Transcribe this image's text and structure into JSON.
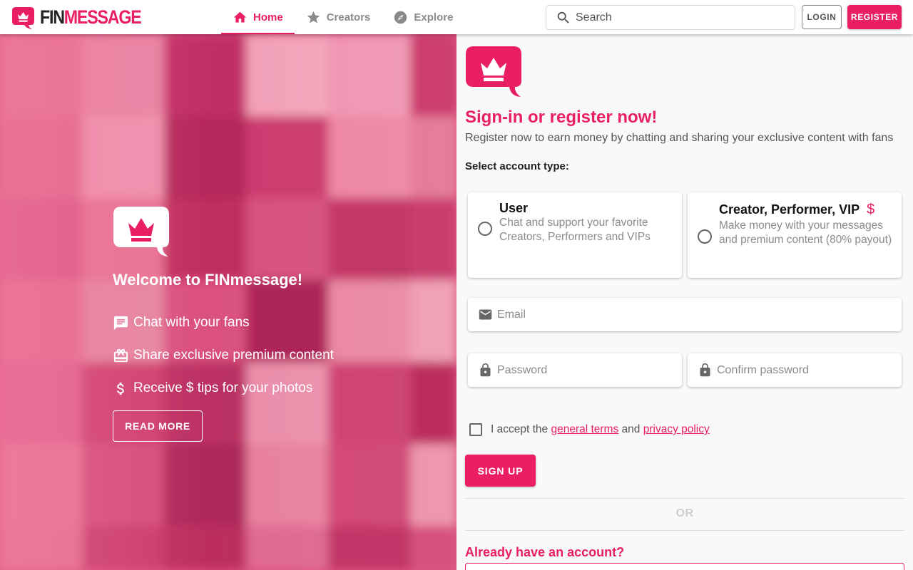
{
  "brand": {
    "name_part1": "FIN",
    "name_part2": "MESSAGE",
    "accent_color": "#e91e63",
    "logo_icon": "crown-chat-bubble-icon"
  },
  "nav": {
    "tabs": [
      {
        "label": "Home",
        "icon": "home-icon",
        "active": true
      },
      {
        "label": "Creators",
        "icon": "star-icon",
        "active": false
      },
      {
        "label": "Explore",
        "icon": "compass-icon",
        "active": false
      }
    ]
  },
  "search": {
    "placeholder": "Search",
    "icon": "search-icon"
  },
  "auth_buttons": {
    "login": "LOGIN",
    "register": "REGISTER"
  },
  "hero": {
    "title": "Welcome to FINmessage!",
    "features": [
      {
        "icon": "chat-icon",
        "text": "Chat with your fans"
      },
      {
        "icon": "gift-card-icon",
        "text": "Share exclusive premium content"
      },
      {
        "icon": "dollar-icon",
        "text": "Receive $ tips for your photos"
      }
    ],
    "read_more": "READ MORE"
  },
  "signup": {
    "title": "Sign-in or register now!",
    "subtitle": "Register now to earn money by chatting and sharing your exclusive content with fans",
    "account_type_label": "Select account type:",
    "account_types": [
      {
        "title": "User",
        "description": "Chat and support your favorite Creators, Performers and VIPs",
        "selected": false
      },
      {
        "title": "Creator, Performer, VIP",
        "title_suffix": "$",
        "description": "Make money with your messages and premium content (80% payout)",
        "selected": false
      }
    ],
    "email_placeholder": "Email",
    "password_placeholder": "Password",
    "confirm_password_placeholder": "Confirm password",
    "terms_prefix": "I accept the",
    "terms_link": "general terms",
    "terms_and": "and",
    "privacy_link": "privacy policy",
    "terms_checked": false,
    "sign_up": "SIGN UP",
    "or": "OR",
    "already_have_account": "Already have an account?"
  }
}
